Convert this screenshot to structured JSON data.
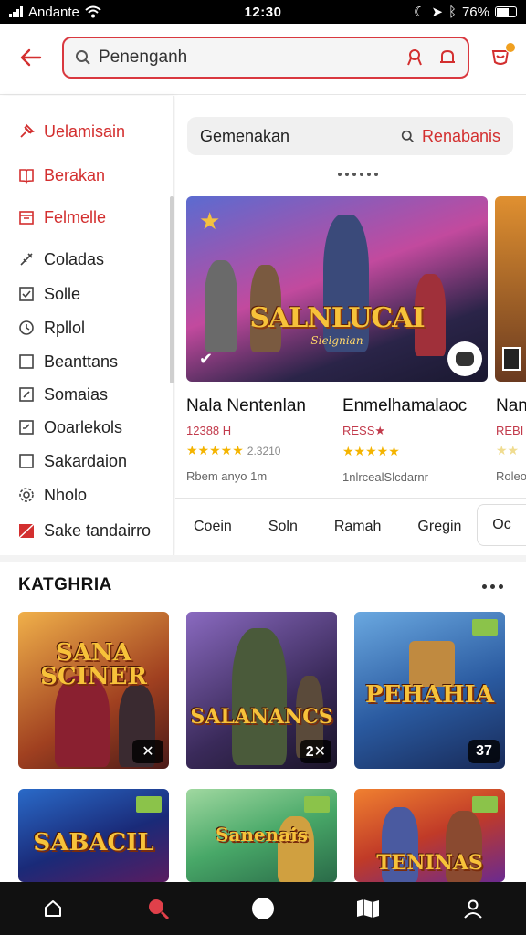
{
  "status": {
    "carrier": "Andante",
    "time": "12:30",
    "battery": "76%"
  },
  "header": {
    "search_placeholder": "Penenganh",
    "back_icon": "arrow-left-icon",
    "notification_icon": "bell-badge-icon"
  },
  "sidebar": {
    "items": [
      {
        "label": "Uelamisain",
        "icon": "pin-icon",
        "active": true
      },
      {
        "label": "Berakan",
        "icon": "book-icon",
        "active": true
      },
      {
        "label": "Felmelle",
        "icon": "calendar-icon",
        "active": true
      },
      {
        "label": "Coladas",
        "icon": "tag-icon",
        "active": false
      },
      {
        "label": "Solle",
        "icon": "check-square-icon",
        "active": false
      },
      {
        "label": "Rpllol",
        "icon": "clock-icon",
        "active": false
      },
      {
        "label": "Beanttans",
        "icon": "square-icon",
        "active": false
      },
      {
        "label": "Somaias",
        "icon": "edit-square-icon",
        "active": false
      },
      {
        "label": "Ooarlekols",
        "icon": "edit-square-icon",
        "active": false
      },
      {
        "label": "Sakardaion",
        "icon": "square-icon",
        "active": false
      },
      {
        "label": "Nholo",
        "icon": "gear-icon",
        "active": false
      },
      {
        "label": "Sake tandairro",
        "icon": "flag-icon",
        "active": false
      }
    ]
  },
  "filter": {
    "label": "Gemenakan",
    "action": "Renabanis"
  },
  "featured": [
    {
      "title": "Nala Nentenlan",
      "logo": "SALNLUCAI",
      "logo_sub": "Sielgnian",
      "meta": "12388 H",
      "stars": "★★★★★",
      "rating_text": "2.3210",
      "foot": "Rbem anyo 1m"
    },
    {
      "title": "Enmelhamalaoc",
      "logo": "",
      "meta": "RESS★",
      "stars": "★★★★★",
      "rating_text": "",
      "foot": "1nlrcealSlcdarnr"
    },
    {
      "title": "Nan",
      "meta": "REBI",
      "stars": "★★",
      "foot": "Roleo"
    }
  ],
  "chips": [
    "Coein",
    "Soln",
    "Ramah",
    "Gregin"
  ],
  "chip_more": "Oc",
  "section": {
    "title": "KATGHRIA"
  },
  "tiles": [
    {
      "logo": "SANA\nSCINER",
      "badge": "✕",
      "colors": [
        "#e8a040",
        "#7a2a20"
      ]
    },
    {
      "logo": "SALANANCS",
      "badge": "2✕",
      "colors": [
        "#7a5fb0",
        "#2a2040"
      ]
    },
    {
      "logo": "PEHAHIA",
      "badge": "37",
      "colors": [
        "#3a78c0",
        "#1a2a58"
      ]
    },
    {
      "logo": "SABACIL",
      "badge": "",
      "colors": [
        "#1e4c9a",
        "#5a1c60"
      ]
    },
    {
      "logo": "Sanenais",
      "badge": "",
      "colors": [
        "#48a868",
        "#a8d0a8"
      ]
    },
    {
      "logo": "TENINAS",
      "badge": "",
      "colors": [
        "#e86020",
        "#6a2a90"
      ]
    }
  ],
  "colors": {
    "accent": "#d32f2f",
    "star": "#f4b400",
    "nav_bg": "#111111"
  }
}
